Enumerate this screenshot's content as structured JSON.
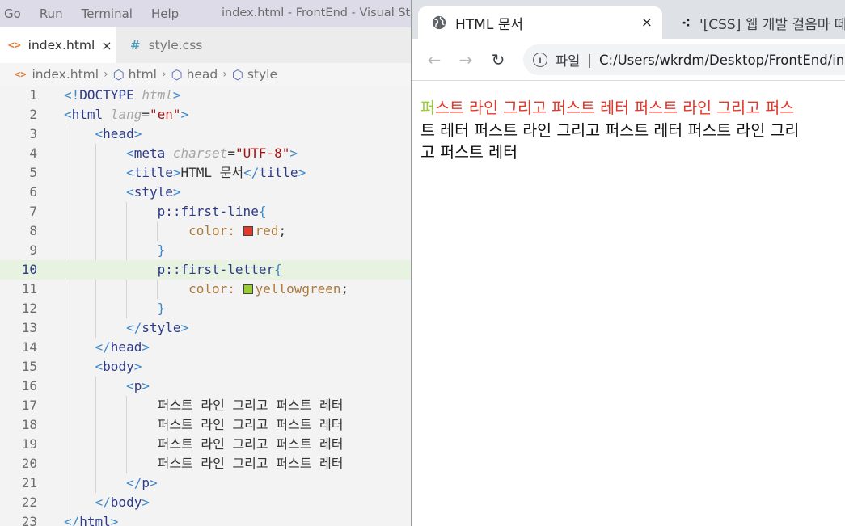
{
  "vscode": {
    "menu": [
      "Go",
      "Run",
      "Terminal",
      "Help"
    ],
    "window_title": "index.html - FrontEnd - Visual Studi",
    "tabs": {
      "active": {
        "icon": "<>",
        "label": "index.html",
        "close": "×"
      },
      "inactive": {
        "icon": "#",
        "label": "style.css"
      }
    },
    "breadcrumb": {
      "file": "index.html",
      "items": [
        "html",
        "head",
        "style"
      ]
    },
    "line_numbers": [
      "1",
      "2",
      "3",
      "4",
      "5",
      "6",
      "7",
      "8",
      "9",
      "10",
      "11",
      "12",
      "13",
      "14",
      "15",
      "16",
      "17",
      "18",
      "19",
      "20",
      "21",
      "22",
      "23"
    ],
    "highlighted_line": 10,
    "code_text": [
      "퍼스트 라인 그리고 퍼스트 레터",
      "퍼스트 라인 그리고 퍼스트 레터",
      "퍼스트 라인 그리고 퍼스트 레터",
      "퍼스트 라인 그리고 퍼스트 레터"
    ],
    "swatch_colors": {
      "red": "#e3392c",
      "yellowgreen": "#9acd32"
    }
  },
  "chrome": {
    "tabs": {
      "active": {
        "icon": "globe-icon",
        "title": "HTML 문서",
        "close": "×"
      },
      "inactive": {
        "icon": "dots-icon",
        "title": "'[CSS] 웹 개발 걸음마 떼"
      }
    },
    "address": {
      "label": "파일",
      "separator": "|",
      "url": "C:/Users/wkrdm/Desktop/FrontEnd/ind"
    },
    "rendered": {
      "first_letter": "퍼",
      "first_line_rest": "스트 라인 그리고 퍼스트 레터 퍼스트 라인 그리고 퍼스",
      "line2": "트 레터 퍼스트 라인 그리고 퍼스트 레터 퍼스트 라인 그리",
      "line3": "고 퍼스트 레터"
    },
    "colors": {
      "first_line": "#e3392c",
      "first_letter": "#9acd32"
    }
  }
}
